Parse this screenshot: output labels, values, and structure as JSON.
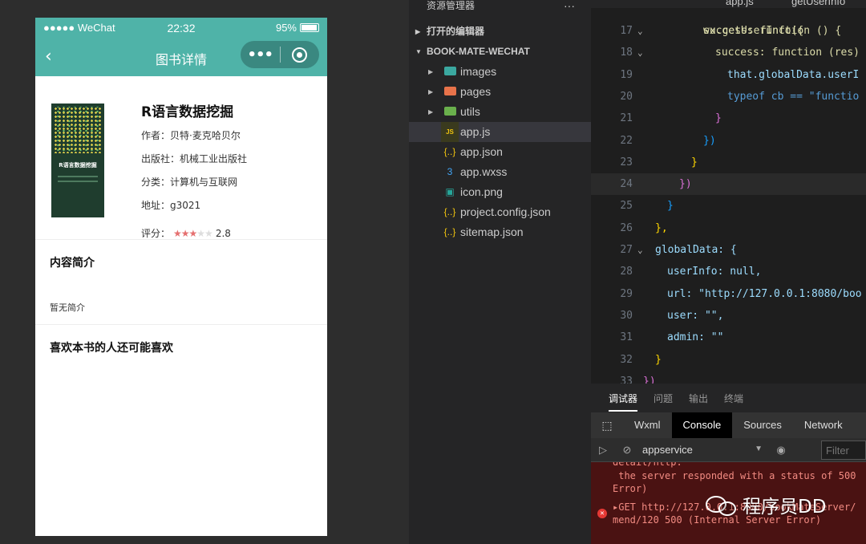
{
  "simulator": {
    "status": {
      "signal": "●●●●● WeChat",
      "time": "22:32",
      "battery": "95%"
    },
    "nav": {
      "title": "图书详情",
      "more": "•••"
    },
    "book": {
      "title": "R语言数据挖掘",
      "author": "作者：贝特·麦克哈贝尔",
      "publisher": "出版社：机械工业出版社",
      "category": "分类：计算机与互联网",
      "address": "地址：g3021",
      "rating_label": "评分：",
      "rating": "2.8",
      "cover_title": "R语言数据挖掘"
    },
    "intro": {
      "heading": "内容简介",
      "text": "暂无简介"
    },
    "recommend": {
      "heading": "喜欢本书的人还可能喜欢"
    }
  },
  "explorer": {
    "title": "资源管理器",
    "more": "···",
    "section_open": "打开的编辑器",
    "section_project": "BOOK-MATE-WECHAT",
    "items": [
      {
        "label": "images",
        "kind": "folder",
        "color": "#3ba8a0"
      },
      {
        "label": "pages",
        "kind": "folder",
        "color": "#e8734a"
      },
      {
        "label": "utils",
        "kind": "folder",
        "color": "#6ab04c"
      },
      {
        "label": "app.js",
        "kind": "js",
        "icon": "JS"
      },
      {
        "label": "app.json",
        "kind": "json",
        "icon": "{..}"
      },
      {
        "label": "app.wxss",
        "kind": "css",
        "icon": "3"
      },
      {
        "label": "icon.png",
        "kind": "png",
        "icon": "▣"
      },
      {
        "label": "project.config.json",
        "kind": "json",
        "icon": "{..}"
      },
      {
        "label": "sitemap.json",
        "kind": "json",
        "icon": "{..}"
      }
    ]
  },
  "editor": {
    "tab": "app.js",
    "breadcrumb": "getUserInfo",
    "top_partial": "success: function () {",
    "lines": [
      {
        "n": "17",
        "code": "wx.getUserInfo({"
      },
      {
        "n": "18",
        "code": "success: function (res) {"
      },
      {
        "n": "19",
        "code": "that.globalData.userI"
      },
      {
        "n": "20",
        "code": "typeof cb == \"functio"
      },
      {
        "n": "21",
        "code": "}"
      },
      {
        "n": "22",
        "code": "})"
      },
      {
        "n": "23",
        "code": "}"
      },
      {
        "n": "24",
        "code": "})"
      },
      {
        "n": "25",
        "code": "}"
      },
      {
        "n": "26",
        "code": "},"
      },
      {
        "n": "27",
        "code": "globalData: {"
      },
      {
        "n": "28",
        "code": "userInfo: null,"
      },
      {
        "n": "29",
        "code": "url: \"http://127.0.0.1:8080/boo"
      },
      {
        "n": "30",
        "code": "user: \"\","
      },
      {
        "n": "31",
        "code": "admin: \"\""
      },
      {
        "n": "32",
        "code": "}"
      },
      {
        "n": "33",
        "code": "})"
      }
    ]
  },
  "debugger": {
    "tabs": [
      "调试器",
      "问题",
      "输出",
      "终端"
    ],
    "panel_tabs": [
      "Wxml",
      "Console",
      "Sources",
      "Network"
    ],
    "context": "appservice",
    "filter_placeholder": "Filter",
    "console_lines": [
      "detail/http:",
      " the server responded with a status of 500",
      "Error)",
      "▸GET http://127.0.0.1:8080/bookMateServer/",
      "mend/120 500 (Internal Server Error)"
    ]
  },
  "watermark": "程序员DD"
}
